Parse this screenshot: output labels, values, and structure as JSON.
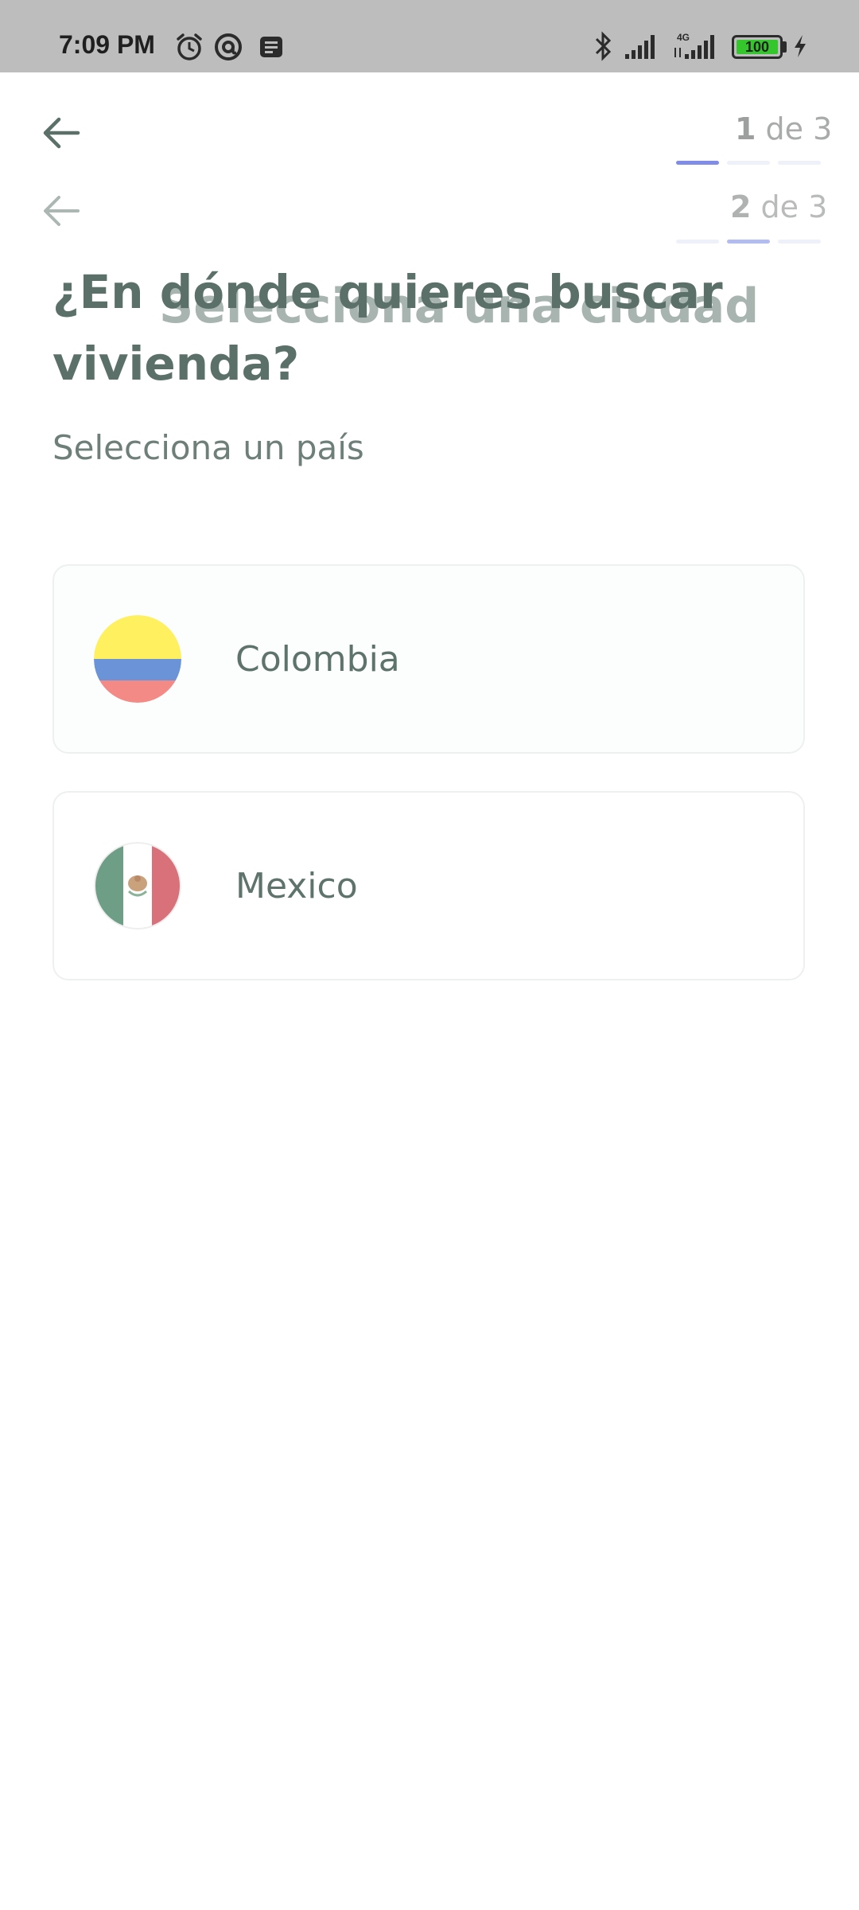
{
  "status_bar": {
    "time": "7:09 PM",
    "icons_left": [
      "alarm-icon",
      "vpn-icon",
      "notification-icon"
    ],
    "icons_right": [
      "bluetooth-icon",
      "signal-icon",
      "signal-4g-icon",
      "battery-icon",
      "charging-icon"
    ],
    "network_label": "4G",
    "battery_level": "100"
  },
  "step_one": {
    "current": "1",
    "separator": "de",
    "total": "3",
    "active_segment": 1
  },
  "step_two": {
    "current": "2",
    "separator": "de",
    "total": "3",
    "active_segment": 2
  },
  "ghost_title": "Selecciona una ciudad",
  "title": "¿En dónde quieres buscar vivienda?",
  "subtitle": "Selecciona un país",
  "countries": [
    {
      "name": "Colombia",
      "flag": "colombia-flag"
    },
    {
      "name": "Mexico",
      "flag": "mexico-flag"
    }
  ],
  "colors": {
    "accent": "#7f8de8",
    "text": "#5c706a"
  }
}
